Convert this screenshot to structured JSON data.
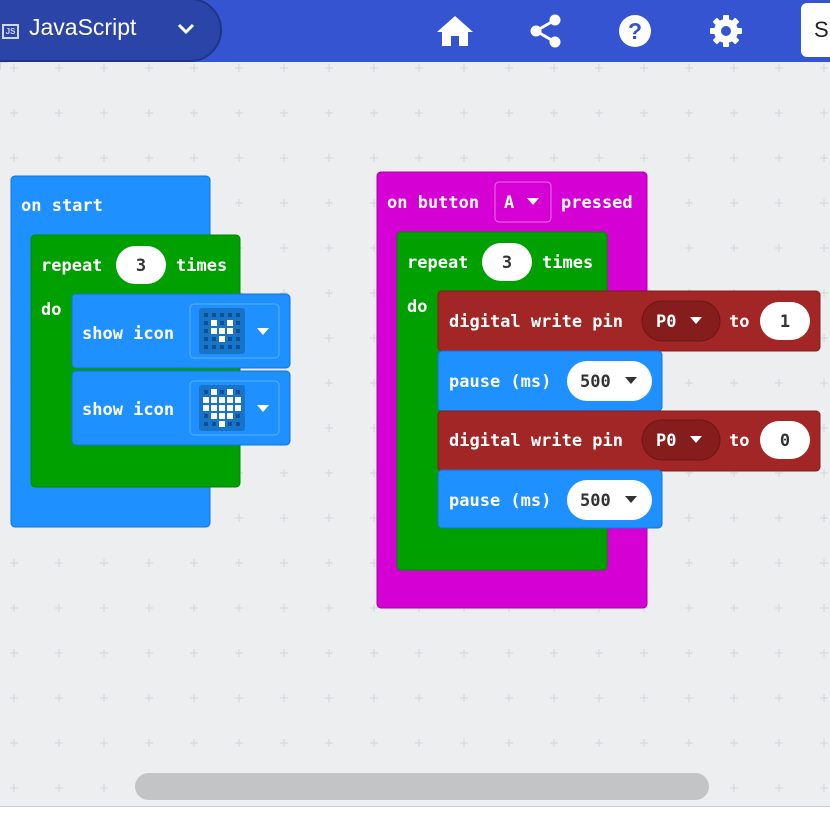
{
  "toolbar": {
    "lang_badge": "JS",
    "language": "JavaScript",
    "sim_label": "Si"
  },
  "colors": {
    "toolbar": "#3454d1",
    "basic_block": "#1e90ff",
    "loop_block": "#00a000",
    "event_block": "#d400d4",
    "pin_block": "#a32626"
  },
  "start_block": {
    "header": "on start",
    "repeat_label": "repeat",
    "repeat_count": "3",
    "times_label": "times",
    "do_label": "do",
    "show_icon_1": "show icon",
    "show_icon_2": "show icon"
  },
  "button_block": {
    "on_label": "on button",
    "button_value": "A",
    "pressed_label": "pressed",
    "repeat_label": "repeat",
    "repeat_count": "3",
    "times_label": "times",
    "do_label": "do",
    "write1_label": "digital write pin",
    "write1_pin": "P0",
    "write1_to": "to",
    "write1_value": "1",
    "pause1_label": "pause (ms)",
    "pause1_value": "500",
    "write2_label": "digital write pin",
    "write2_pin": "P0",
    "write2_to": "to",
    "write2_value": "0",
    "pause2_label": "pause (ms)",
    "pause2_value": "500"
  },
  "icons": {
    "home": "home-icon",
    "share": "share-icon",
    "help": "help-icon",
    "settings": "gear-icon",
    "small_heart": "small-heart-icon",
    "heart": "heart-icon"
  }
}
